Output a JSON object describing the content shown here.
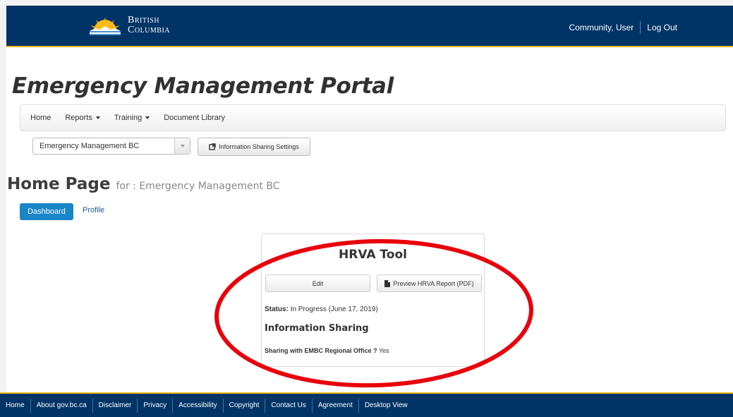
{
  "header": {
    "logo_line1": "British",
    "logo_line2": "Columbia",
    "user_name": "Community, User",
    "logout_label": "Log Out"
  },
  "portal_title": "Emergency Management Portal",
  "nav": {
    "items": [
      {
        "label": "Home",
        "has_caret": false
      },
      {
        "label": "Reports",
        "has_caret": true
      },
      {
        "label": "Training",
        "has_caret": true
      },
      {
        "label": "Document Library",
        "has_caret": false
      }
    ]
  },
  "org_select": {
    "selected": "Emergency Management BC"
  },
  "share_settings_label": "Information Sharing Settings",
  "home_heading": {
    "title": "Home Page",
    "for_text": "for : Emergency Management BC"
  },
  "tabs": {
    "dashboard": "Dashboard",
    "profile": "Profile"
  },
  "card": {
    "title": "HRVA Tool",
    "edit_label": "Edit",
    "preview_label": "Preview HRVA Report (PDF)",
    "status_label": "Status:",
    "status_value": "In Progress (June 17, 2019)",
    "info_heading": "Information Sharing",
    "sharing_label": "Sharing with EMBC Regional Office ?",
    "sharing_value": "Yes"
  },
  "footer": {
    "links": [
      "Home",
      "About gov.bc.ca",
      "Disclaimer",
      "Privacy",
      "Accessibility",
      "Copyright",
      "Contact Us",
      "Agreement",
      "Desktop View"
    ]
  },
  "colors": {
    "header_bg": "#003366",
    "accent_gold": "#fcba19",
    "primary_blue": "#1a85c8",
    "annotation_red": "#e8000b"
  }
}
